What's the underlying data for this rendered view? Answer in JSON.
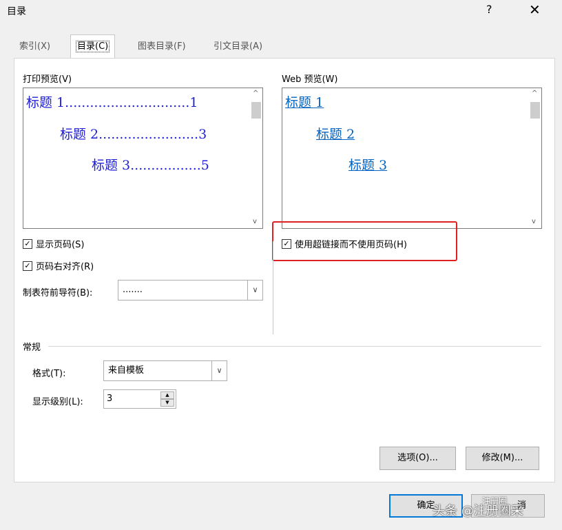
{
  "window": {
    "title": "目录",
    "help_label": "?",
    "close_label": "✕"
  },
  "tabs": [
    {
      "label": "索引(X)"
    },
    {
      "label": "目录(C)"
    },
    {
      "label": "图表目录(F)"
    },
    {
      "label": "引文目录(A)"
    }
  ],
  "print_preview": {
    "label": "打印预览(V)",
    "entries": [
      {
        "text": "标题 1..............................1"
      },
      {
        "text": "标题 2........................3"
      },
      {
        "text": "标题 3.................5"
      }
    ]
  },
  "web_preview": {
    "label": "Web 预览(W)",
    "entries": [
      {
        "text": "标题 1"
      },
      {
        "text": "标题 2"
      },
      {
        "text": "标题 3"
      }
    ]
  },
  "options": {
    "show_page_numbers": {
      "label": "显示页码(S)",
      "checked": true
    },
    "right_align": {
      "label": "页码右对齐(R)",
      "checked": true
    },
    "use_hyperlinks": {
      "label": "使用超链接而不使用页码(H)",
      "checked": true
    },
    "tab_leader_label": "制表符前导符(B):",
    "tab_leader_value": "......."
  },
  "general": {
    "section_label": "常规",
    "format_label": "格式(T):",
    "format_value": "来自模板",
    "levels_label": "显示级别(L):",
    "levels_value": "3"
  },
  "buttons": {
    "options": "选项(O)...",
    "modify": "修改(M)...",
    "ok": "确定",
    "cancel": "消"
  },
  "watermark": {
    "text": "头条 @注册圈采",
    "icon_text": "注册圈"
  },
  "icons": {
    "checkmark": "✓",
    "arrow_up": "▲",
    "arrow_down": "▼",
    "chevron_up": "^",
    "chevron_down": "v",
    "select_arrow": "∨"
  },
  "colors": {
    "print_heading": "#1f1fd6",
    "web_link": "#0563c1",
    "highlight_box": "#e02020",
    "ok_border": "#0078d7"
  }
}
